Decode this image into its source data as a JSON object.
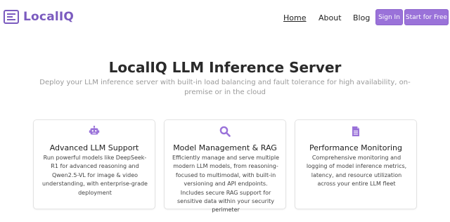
{
  "brand": {
    "name": "LocalIQ"
  },
  "nav": {
    "home": "Home",
    "about": "About",
    "blog": "Blog"
  },
  "actions": {
    "signin": "Sign In",
    "start": "Start for Free"
  },
  "hero": {
    "title": "LocalIQ LLM Inference Server",
    "subtitle": "Deploy your LLM inference server with built-in load balancing and fault tolerance for high availability, on-premise or in the cloud"
  },
  "features": [
    {
      "icon": "robot-icon",
      "title": "Advanced LLM Support",
      "description": "Run powerful models like DeepSeek-R1 for advanced reasoning and Qwen2.5-VL for image & video understanding, with enterprise-grade deployment"
    },
    {
      "icon": "search-icon",
      "title": "Model Management & RAG",
      "description": "Efficiently manage and serve multiple modern LLM models, from reasoning-focused to multimodal, with built-in versioning and API endpoints. Includes secure RAG support for sensitive data within your security perimeter"
    },
    {
      "icon": "document-icon",
      "title": "Performance Monitoring",
      "description": "Comprehensive monitoring and logging of model inference metrics, latency, and resource utilization across your entire LLM fleet"
    }
  ],
  "colors": {
    "accent": "#9a72d9",
    "brand": "#7b5bbf",
    "subtitle": "#9a9a9a"
  }
}
